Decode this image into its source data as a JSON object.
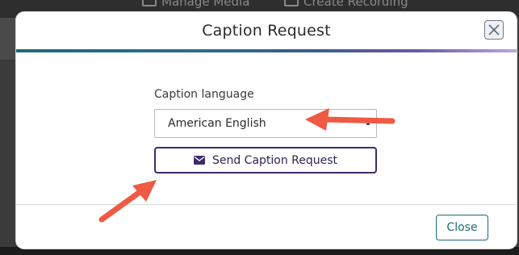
{
  "background": {
    "tabs": [
      {
        "label": "Manage Media",
        "icon": "media-icon"
      },
      {
        "label": "Create Recording",
        "icon": "recording-icon"
      }
    ]
  },
  "modal": {
    "title": "Caption Request",
    "close_icon": "close-x-icon",
    "caption_language_label": "Caption language",
    "caption_language_value": "American English",
    "send_button_label": "Send Caption Request",
    "send_button_icon": "envelope-icon",
    "close_button_label": "Close"
  },
  "colors": {
    "accent_teal": "#1b6b74",
    "accent_purple": "#3d2b6d",
    "annotation_arrow": "#ee5a43"
  }
}
